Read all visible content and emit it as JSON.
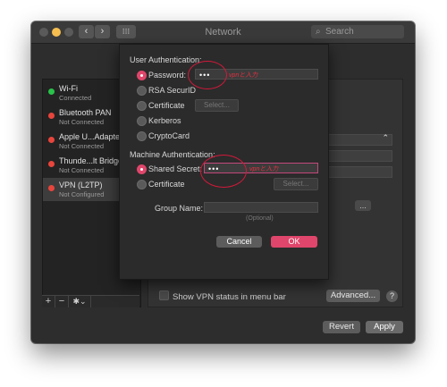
{
  "window": {
    "title": "Network"
  },
  "toolbar": {
    "back_label": "‹",
    "forward_label": "›",
    "grid_label": "⁝⁝⁝",
    "search_placeholder": "Search"
  },
  "sidebar": {
    "items": [
      {
        "name": "Wi-Fi",
        "status": "Connected",
        "dot_color": "#29c24a"
      },
      {
        "name": "Bluetooth PAN",
        "status": "Not Connected",
        "dot_color": "#e8453c"
      },
      {
        "name": "Apple U...Adapter",
        "status": "Not Connected",
        "dot_color": "#e8453c"
      },
      {
        "name": "Thunde...lt Bridge",
        "status": "Not Connected",
        "dot_color": "#e8453c"
      },
      {
        "name": "VPN (L2TP)",
        "status": "Not Configured",
        "dot_color": "#e8453c"
      }
    ],
    "add_label": "+",
    "remove_label": "−",
    "gear_label": "✱⌄"
  },
  "sheet": {
    "user_auth_heading": "User Authentication:",
    "user_auth_options": [
      {
        "label": "Password:",
        "selected": true
      },
      {
        "label": "RSA SecurID",
        "selected": false
      },
      {
        "label": "Certificate",
        "selected": false
      },
      {
        "label": "Kerberos",
        "selected": false
      },
      {
        "label": "CryptoCard",
        "selected": false
      }
    ],
    "password_value": "•••",
    "certificate_select_label": "Select...",
    "machine_auth_heading": "Machine Authentication:",
    "machine_auth_options": [
      {
        "label": "Shared Secret:",
        "selected": true
      },
      {
        "label": "Certificate",
        "selected": false
      }
    ],
    "shared_secret_value": "•••",
    "machine_cert_select_label": "Select...",
    "group_name_label": "Group Name:",
    "group_name_value": "",
    "group_name_hint": "(Optional)",
    "cancel_label": "Cancel",
    "ok_label": "OK",
    "annotation_password": "vpnと入力",
    "annotation_secret": "vpnと入力"
  },
  "detail": {
    "show_vpn_label": "Show VPN status in menu bar",
    "advanced_label": "Advanced...",
    "help_label": "?",
    "partial_button_label": "..."
  },
  "footer": {
    "revert_label": "Revert",
    "apply_label": "Apply"
  },
  "colors": {
    "accent": "#e0466b",
    "annotation": "#d2193a",
    "window_bg": "#2d2d2d"
  }
}
